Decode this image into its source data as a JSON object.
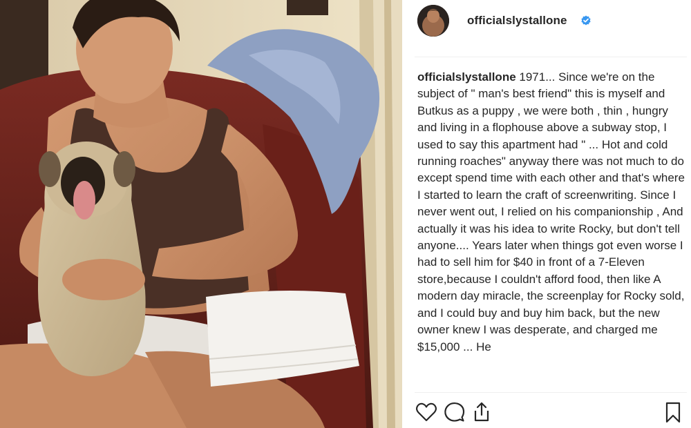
{
  "post": {
    "username": "officialslystallone",
    "verified": true,
    "caption_user": "officialslystallone",
    "caption_text": " 1971... Since we're on the subject of \" man's best friend\" this is myself and Butkus as a puppy , we were both , thin , hungry and living in a flophouse above a subway stop, I used to say this apartment had \" ... Hot and cold running roaches\" anyway there was not much to do except spend time with each other and that's where I started to learn the craft of screenwriting. Since I never went out, I relied on his companionship , And actually it was his idea to write Rocky, but don't tell anyone.... Years later when things got even worse I had to sell him for $40 in front of a 7-Eleven store,because I couldn't afford food, then like A modern day miracle, the screenplay for Rocky sold, and I could buy and buy him back, but the new owner knew I was desperate, and charged me $15,000 ... He"
  },
  "icons": {
    "like": "heart-icon",
    "comment": "comment-bubble-icon",
    "share": "share-icon",
    "save": "bookmark-icon",
    "verified": "verified-badge-icon"
  },
  "colors": {
    "text": "#262626",
    "verified_blue": "#3897f0",
    "divider": "#efefef"
  }
}
